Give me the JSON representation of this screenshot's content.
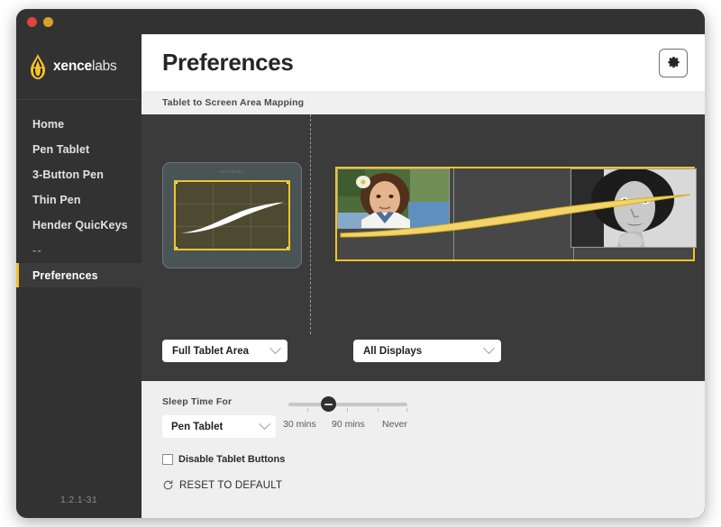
{
  "window": {
    "traffic_lights": [
      "close",
      "minimize"
    ]
  },
  "sidebar": {
    "brand": {
      "bold": "xence",
      "light": "labs",
      "logo_icon": "flame-logo-icon"
    },
    "items": [
      {
        "label": "Home",
        "active": false
      },
      {
        "label": "Pen Tablet",
        "active": false
      },
      {
        "label": "3-Button Pen",
        "active": false
      },
      {
        "label": "Thin Pen",
        "active": false
      },
      {
        "label": "Hender QuicKeys",
        "active": false
      },
      {
        "label": "--",
        "active": false
      },
      {
        "label": "Preferences",
        "active": true
      }
    ],
    "version": "1.2.1-31"
  },
  "header": {
    "title": "Preferences",
    "settings_icon": "gear-icon"
  },
  "mapping": {
    "section_label": "Tablet to Screen Area Mapping",
    "tablet_brand": "xencelabs",
    "tablet_dropdown": {
      "value": "Full Tablet Area",
      "chevron": "chevron-down-icon"
    },
    "display_dropdown": {
      "value": "All Displays",
      "chevron": "chevron-down-icon"
    }
  },
  "sleep": {
    "label": "Sleep Time For",
    "device_dropdown": {
      "value": "Pen Tablet",
      "chevron": "chevron-down-icon"
    },
    "slider": {
      "labels": [
        "30 mins",
        "90 mins",
        "Never"
      ],
      "position_percent": 33
    },
    "checkbox": {
      "label": "Disable Tablet Buttons",
      "checked": false
    },
    "reset": {
      "label": "RESET TO DEFAULT",
      "icon": "refresh-icon"
    }
  },
  "colors": {
    "accent_yellow": "#eec52a",
    "sidebar_bg": "#323232",
    "panel_bg": "#3b3b3b",
    "light_panel_bg": "#efefef"
  }
}
